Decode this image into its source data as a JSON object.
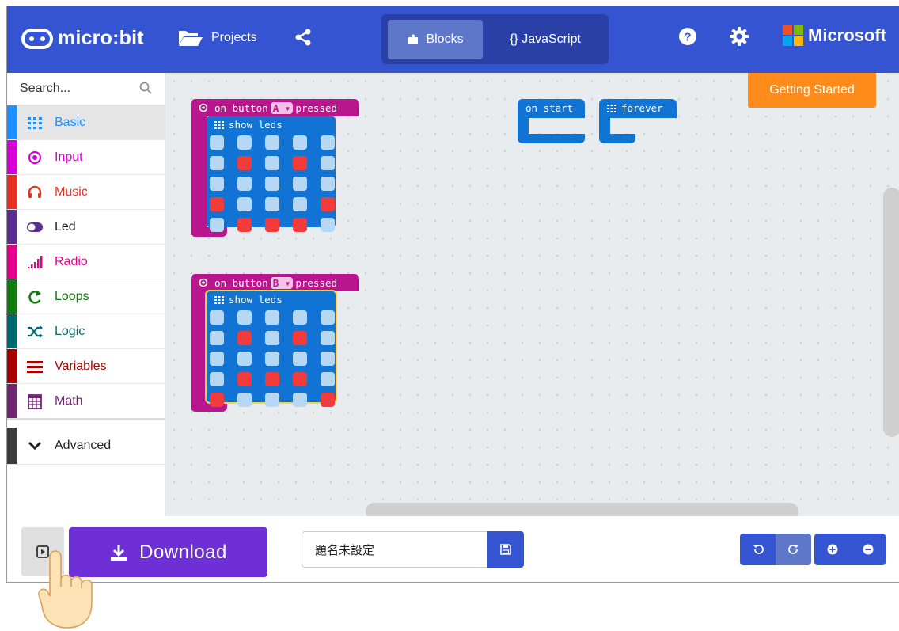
{
  "header": {
    "logo_text": "micro:bit",
    "projects_label": "Projects",
    "tabs": [
      {
        "label": "Blocks",
        "active": true
      },
      {
        "label": "{} JavaScript",
        "active": false
      }
    ],
    "brand": "Microsoft",
    "colors": {
      "header_bg": "#3454d1",
      "tab_bg": "#2b40a6",
      "tab_active": "#5e77c9"
    }
  },
  "sidebar": {
    "search_placeholder": "Search...",
    "categories": [
      {
        "label": "Basic",
        "icon": "grid-icon",
        "color": "#1e90ff",
        "label_color": "#1e90ff",
        "selected": true
      },
      {
        "label": "Input",
        "icon": "target-icon",
        "color": "#d400d4",
        "label_color": "#d400d4"
      },
      {
        "label": "Music",
        "icon": "headphones-icon",
        "color": "#e63022",
        "label_color": "#e63022"
      },
      {
        "label": "Led",
        "icon": "toggle-icon",
        "color": "#5c2d91",
        "label_color": "#222222"
      },
      {
        "label": "Radio",
        "icon": "signal-icon",
        "color": "#e3008c",
        "label_color": "#e3008c"
      },
      {
        "label": "Loops",
        "icon": "loop-icon",
        "color": "#107c10",
        "label_color": "#107c10"
      },
      {
        "label": "Logic",
        "icon": "shuffle-icon",
        "color": "#006970",
        "label_color": "#006970"
      },
      {
        "label": "Variables",
        "icon": "lines-icon",
        "color": "#a80000",
        "label_color": "#a80000"
      },
      {
        "label": "Math",
        "icon": "calculator-icon",
        "color": "#712672",
        "label_color": "#712672"
      },
      {
        "label": "Advanced",
        "icon": "chevron-down-icon",
        "color": "#3c3c3c",
        "label_color": "#222222"
      }
    ]
  },
  "workspace": {
    "getting_started": "Getting Started",
    "blocks": [
      {
        "hat": {
          "prefix": "on button",
          "button": "A",
          "suffix": "pressed"
        },
        "show_leds_label": "show leds",
        "leds": [
          [
            0,
            0,
            0,
            0,
            0
          ],
          [
            0,
            1,
            0,
            1,
            0
          ],
          [
            0,
            0,
            0,
            0,
            0
          ],
          [
            1,
            0,
            0,
            0,
            1
          ],
          [
            0,
            1,
            1,
            1,
            0
          ]
        ]
      },
      {
        "hat": {
          "prefix": "on button",
          "button": "B",
          "suffix": "pressed"
        },
        "show_leds_label": "show leds",
        "leds": [
          [
            0,
            0,
            0,
            0,
            0
          ],
          [
            0,
            1,
            0,
            1,
            0
          ],
          [
            0,
            0,
            0,
            0,
            0
          ],
          [
            0,
            1,
            1,
            1,
            0
          ],
          [
            1,
            0,
            0,
            0,
            1
          ]
        ]
      }
    ],
    "on_start_label": "on start",
    "forever_label": "forever"
  },
  "bottom": {
    "download_label": "Download",
    "project_name": "題名未設定"
  }
}
